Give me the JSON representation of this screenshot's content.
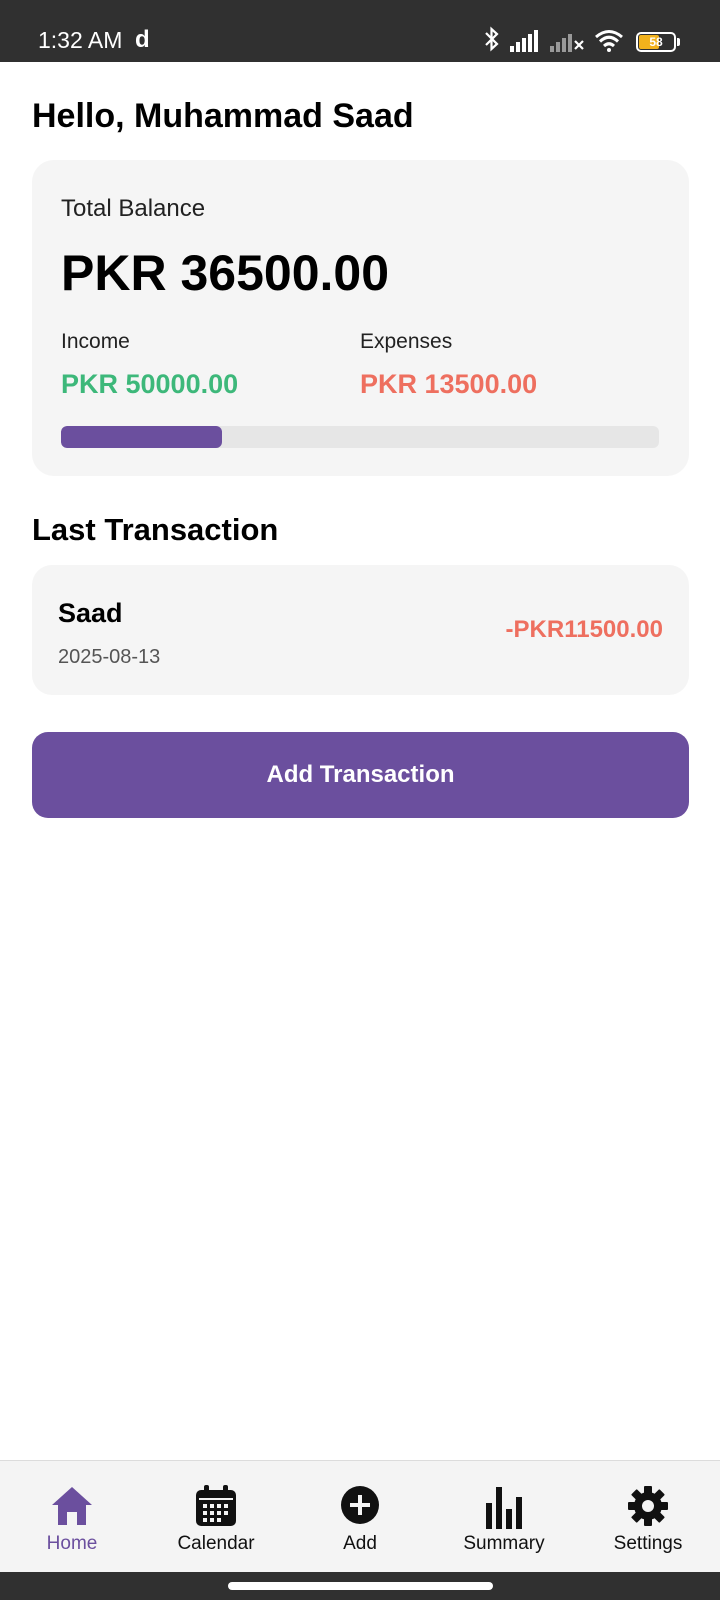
{
  "status_bar": {
    "time": "1:32 AM",
    "extra_glyph": "d",
    "icons": [
      "bluetooth-icon",
      "signal-icon",
      "signal-no-service-icon",
      "wifi-icon",
      "battery-icon"
    ],
    "battery_level": "58",
    "battery_fraction": 0.58
  },
  "greeting": "Hello, Muhammad Saad",
  "balance": {
    "label": "Total Balance",
    "amount": "PKR 36500.00",
    "income_label": "Income",
    "income_amount": "PKR 50000.00",
    "expenses_label": "Expenses",
    "expenses_amount": "PKR 13500.00",
    "expense_ratio": 0.27
  },
  "last_transaction": {
    "title": "Last Transaction",
    "name": "Saad",
    "date": "2025-08-13",
    "amount": "-PKR11500.00"
  },
  "add_button_label": "Add Transaction",
  "nav": [
    {
      "label": "Home",
      "icon": "home-icon",
      "active": true
    },
    {
      "label": "Calendar",
      "icon": "calendar-icon",
      "active": false
    },
    {
      "label": "Add",
      "icon": "add-circle-icon",
      "active": false
    },
    {
      "label": "Summary",
      "icon": "bar-chart-icon",
      "active": false
    },
    {
      "label": "Settings",
      "icon": "gear-icon",
      "active": false
    }
  ],
  "colors": {
    "accent": "#6b4f9e",
    "income": "#3db87a",
    "expense": "#ee6f5f",
    "card": "#f5f5f5",
    "status_bar": "#303030"
  }
}
